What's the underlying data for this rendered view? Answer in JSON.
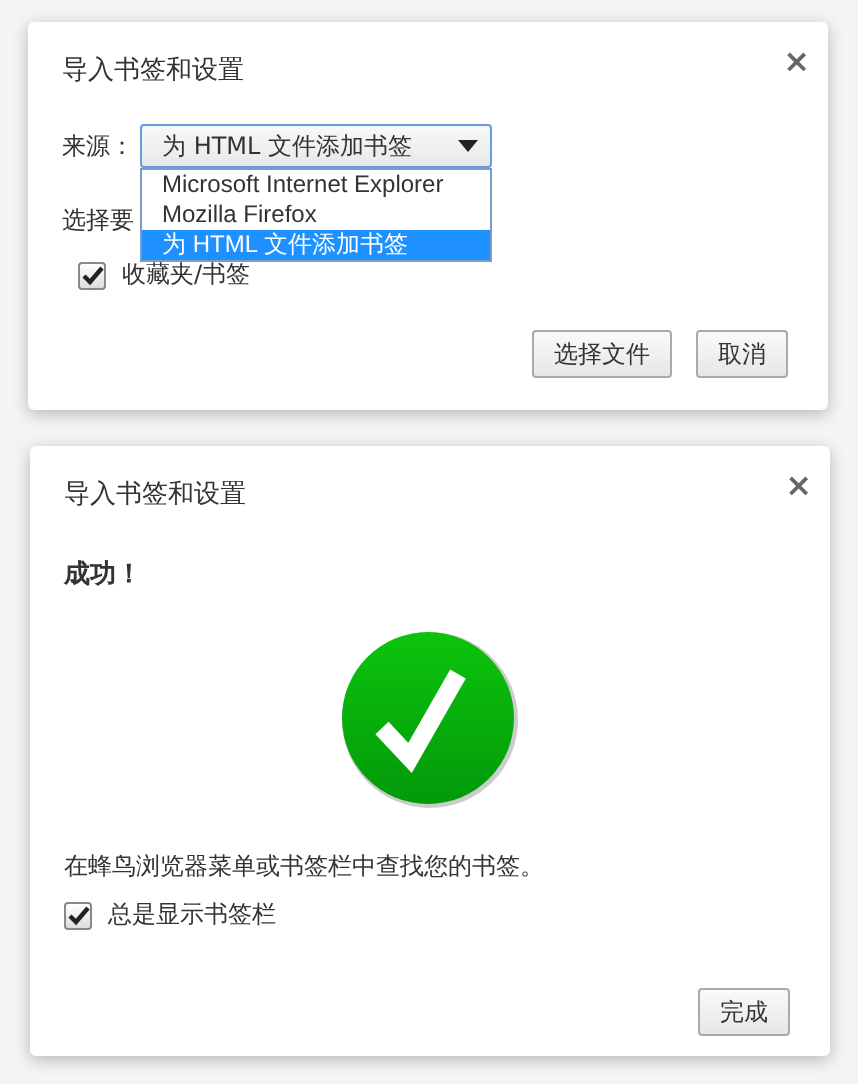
{
  "import_dialog": {
    "title": "导入书签和设置",
    "close": "×",
    "source_label": "来源：",
    "source_value": "为 HTML 文件添加书签",
    "options": [
      {
        "label": "Microsoft Internet Explorer",
        "selected": false
      },
      {
        "label": "Mozilla Firefox",
        "selected": false
      },
      {
        "label": "为 HTML 文件添加书签",
        "selected": true
      }
    ],
    "items_label": "选择要",
    "checkbox": {
      "label": "收藏夹/书签",
      "checked": true
    },
    "buttons": [
      "选择文件",
      "取消"
    ]
  },
  "success_dialog": {
    "title": "导入书签和设置",
    "close": "×",
    "heading": "成功！",
    "message": "在蜂鸟浏览器菜单或书签栏中查找您的书签。",
    "checkbox": {
      "label": "总是显示书签栏",
      "checked": true
    },
    "buttons": [
      "完成"
    ]
  }
}
